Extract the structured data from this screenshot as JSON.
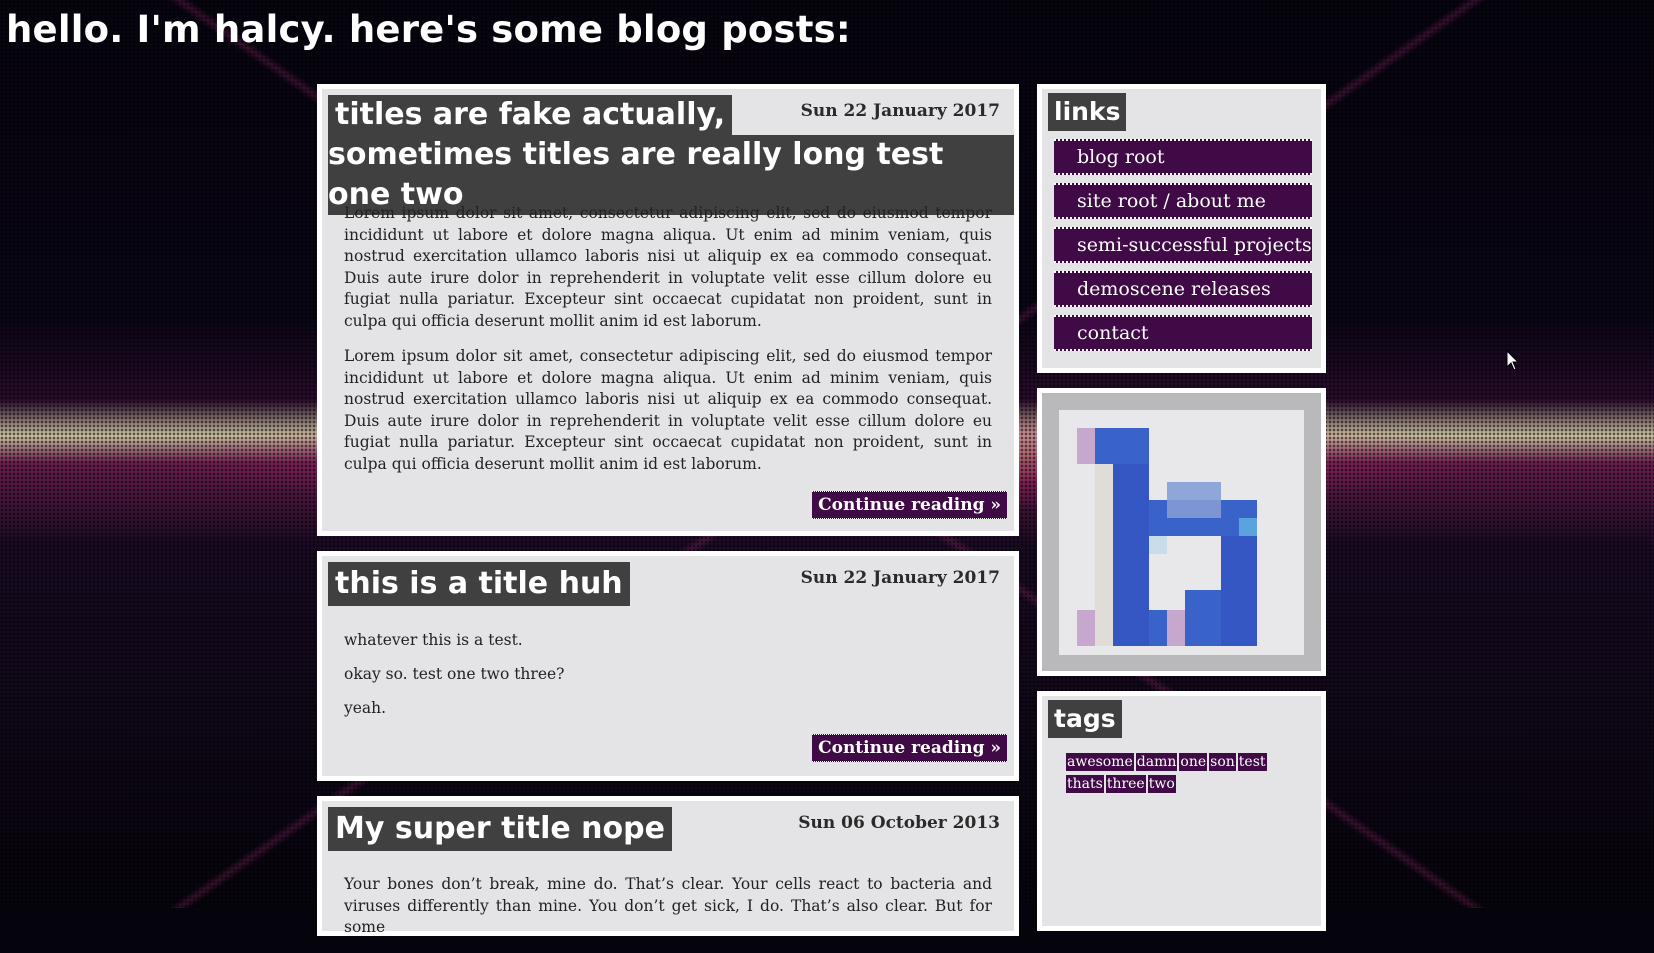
{
  "site": {
    "title": "hello. I'm halcy. here's some blog posts:"
  },
  "posts": [
    {
      "title_lines": [
        "titles are fake actually,",
        "sometimes titles are really long test one two"
      ],
      "date": "Sun 22 January 2017",
      "paragraphs": [
        "Lorem ipsum dolor sit amet, consectetur adipiscing elit, sed do eiusmod tempor incididunt ut labore et dolore magna aliqua. Ut enim ad minim veniam, quis nostrud exercitation ullamco laboris nisi ut aliquip ex ea commodo consequat. Duis aute irure dolor in reprehenderit in voluptate velit esse cillum dolore eu fugiat nulla pariatur. Excepteur sint occaecat cupidatat non proident, sunt in culpa qui officia deserunt mollit anim id est laborum.",
        "Lorem ipsum dolor sit amet, consectetur adipiscing elit, sed do eiusmod tempor incididunt ut labore et dolore magna aliqua. Ut enim ad minim veniam, quis nostrud exercitation ullamco laboris nisi ut aliquip ex ea commodo consequat. Duis aute irure dolor in reprehenderit in voluptate velit esse cillum dolore eu fugiat nulla pariatur. Excepteur sint occaecat cupidatat non proident, sunt in culpa qui officia deserunt mollit anim id est laborum."
      ],
      "continue_label": "Continue reading »"
    },
    {
      "title_lines": [
        "this is a title huh"
      ],
      "date": "Sun 22 January 2017",
      "paragraphs": [
        "whatever this is a test.",
        "okay so. test one two three?",
        "yeah."
      ],
      "continue_label": "Continue reading »"
    },
    {
      "title_lines": [
        "My super title nope"
      ],
      "date": "Sun 06 October 2013",
      "paragraphs": [
        "Your bones don’t break, mine do. That’s clear. Your cells react to bacteria and viruses differently than mine. You don’t get sick, I do. That’s also clear. But for some"
      ]
    }
  ],
  "links": {
    "heading": "links",
    "items": [
      "blog root",
      "site root / about me",
      "semi-successful projects",
      "demoscene releases",
      "contact"
    ]
  },
  "tags": {
    "heading": "tags",
    "items": [
      "awesome",
      "damn",
      "one",
      "son",
      "test",
      "thats",
      "three",
      "two"
    ]
  },
  "colors": {
    "accent": "#3f0a45",
    "panel_bg": "#e4e4e6",
    "title_bg": "#404040",
    "avatar_blue": "#3a63c9"
  },
  "icons": {
    "avatar": "pixel-h-avatar-icon",
    "cursor": "mouse-cursor-icon"
  }
}
